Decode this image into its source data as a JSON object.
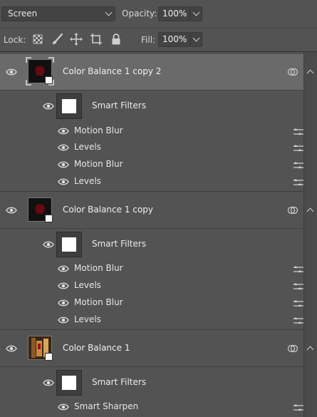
{
  "blend": {
    "mode": "Screen",
    "opacity_label": "Opacity:",
    "opacity_value": "100%"
  },
  "lock": {
    "label": "Lock:",
    "fill_label": "Fill:",
    "fill_value": "100%"
  },
  "layers": [
    {
      "name": "Color Balance 1 copy 2",
      "selected": true,
      "smart_filters_label": "Smart Filters",
      "filters": [
        "Motion Blur",
        "Levels",
        "Motion Blur",
        "Levels"
      ]
    },
    {
      "name": "Color Balance 1 copy",
      "selected": false,
      "smart_filters_label": "Smart Filters",
      "filters": [
        "Motion Blur",
        "Levels",
        "Motion Blur",
        "Levels"
      ]
    },
    {
      "name": "Color Balance 1",
      "selected": false,
      "smart_filters_label": "Smart Filters",
      "filters": [
        "Smart Sharpen"
      ]
    }
  ]
}
